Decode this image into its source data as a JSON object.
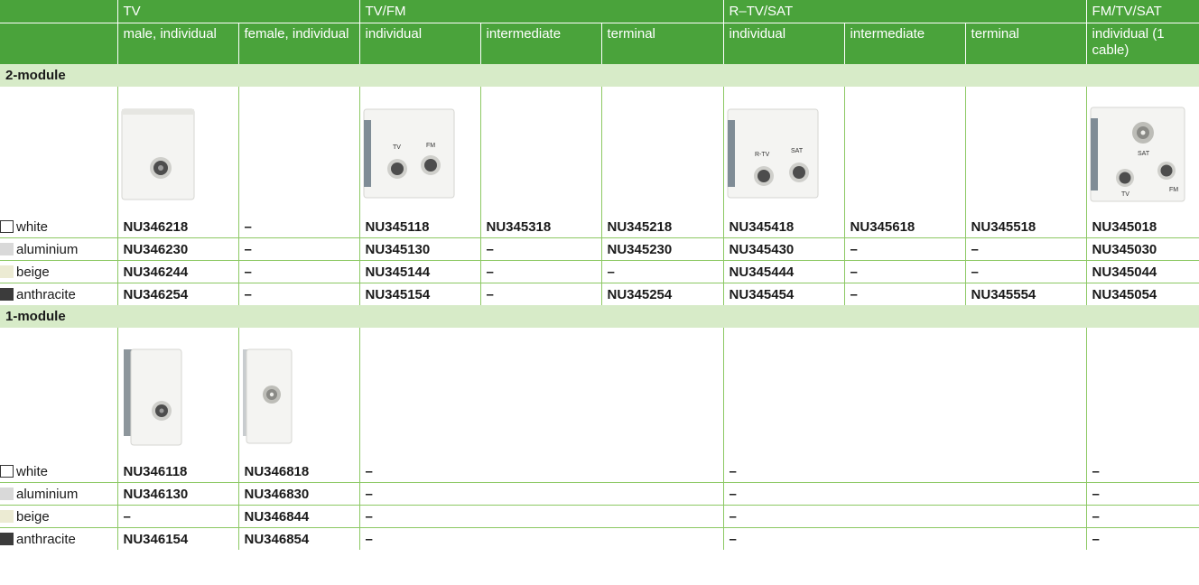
{
  "header": {
    "groups": {
      "tv": "TV",
      "tvfm": "TV/FM",
      "rtvsat": "R–TV/SAT",
      "fmtvsat": "FM/TV/SAT"
    },
    "subheads": {
      "tv_male": "male, individual",
      "tv_female": "female, individual",
      "tvfm_individual": "individual",
      "tvfm_intermediate": "intermediate",
      "tvfm_terminal": "terminal",
      "rtv_individual": "individual",
      "rtv_intermediate": "intermediate",
      "rtv_terminal": "terminal",
      "fmtv_individual": "individual (1 cable)"
    }
  },
  "colors": {
    "white": "#ffffff",
    "aluminium": "#d9d9d9",
    "beige": "#ecebd3",
    "anthracite": "#3b3b3b"
  },
  "images": {
    "socket_tv": "TV",
    "socket_fm": "FM",
    "socket_rtv": "R-TV",
    "socket_sat": "SAT"
  },
  "sections": [
    {
      "title": "2-module",
      "rows": [
        {
          "finish": "white",
          "cells": [
            "NU346218",
            "–",
            "NU345118",
            "NU345318",
            "NU345218",
            "NU345418",
            "NU345618",
            "NU345518",
            "NU345018"
          ]
        },
        {
          "finish": "aluminium",
          "cells": [
            "NU346230",
            "–",
            "NU345130",
            "–",
            "NU345230",
            "NU345430",
            "–",
            "–",
            "NU345030"
          ]
        },
        {
          "finish": "beige",
          "cells": [
            "NU346244",
            "–",
            "NU345144",
            "–",
            "–",
            "NU345444",
            "–",
            "–",
            "NU345044"
          ]
        },
        {
          "finish": "anthracite",
          "cells": [
            "NU346254",
            "–",
            "NU345154",
            "–",
            "NU345254",
            "NU345454",
            "–",
            "NU345554",
            "NU345054"
          ]
        }
      ]
    },
    {
      "title": "1-module",
      "rows": [
        {
          "finish": "white",
          "cells": [
            "NU346118",
            "NU346818",
            "–",
            "–",
            "–"
          ]
        },
        {
          "finish": "aluminium",
          "cells": [
            "NU346130",
            "NU346830",
            "–",
            "–",
            "–"
          ]
        },
        {
          "finish": "beige",
          "cells": [
            "–",
            "NU346844",
            "–",
            "–",
            "–"
          ]
        },
        {
          "finish": "anthracite",
          "cells": [
            "NU346154",
            "NU346854",
            "–",
            "–",
            "–"
          ]
        }
      ]
    }
  ]
}
